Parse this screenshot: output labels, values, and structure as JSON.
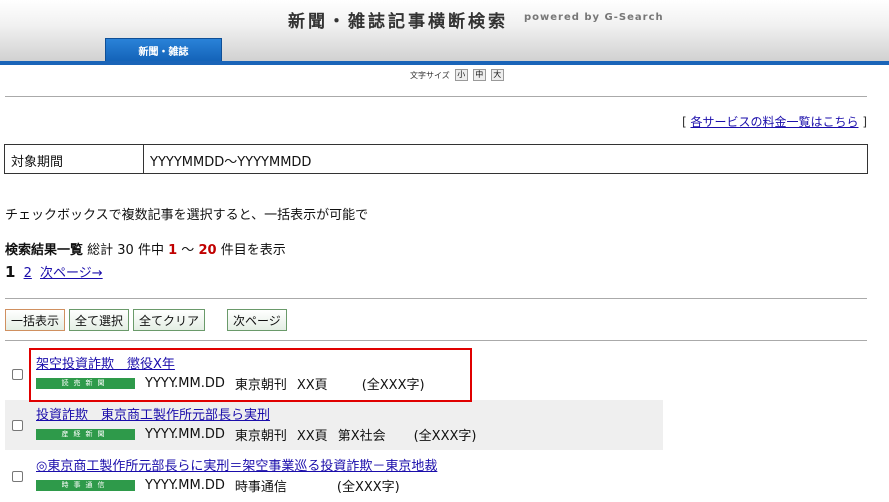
{
  "header": {
    "title": "新聞・雑誌記事横断検索",
    "powered": "powered by G-Search",
    "tab_label": "新聞・雑誌"
  },
  "font_size": {
    "label": "文字サイズ",
    "options": [
      "小",
      "中",
      "大"
    ]
  },
  "price_link": {
    "open": "[ ",
    "label": "各サービスの料金一覧はこちら",
    "close": " ]"
  },
  "period": {
    "label": "対象期間",
    "value": "YYYYMMDD〜YYYYMMDD"
  },
  "hint": "チェックボックスで複数記事を選択すると、一括表示が可能で",
  "summary": {
    "heading": "検索結果一覧",
    "text_pre": "総計 30 件中",
    "from": "1",
    "sep": "〜",
    "to": "20",
    "text_post": "件目を表示"
  },
  "pagination": {
    "current": "1",
    "page2": "2",
    "next": "次ページ→"
  },
  "buttons": {
    "bulk_view": "一括表示",
    "select_all": "全て選択",
    "clear_all": "全てクリア",
    "next_page": "次ページ"
  },
  "results": [
    {
      "title": "架空投資詐欺　懲役X年",
      "source": "読売新聞",
      "date": "YYYY.MM.DD",
      "edition": "東京朝刊",
      "page": "XX頁",
      "section": "",
      "chars": "(全XXX字)"
    },
    {
      "title": "投資詐欺　東京商工製作所元部長ら実刑",
      "source": "産経新聞",
      "date": "YYYY.MM.DD",
      "edition": "東京朝刊",
      "page": "XX頁",
      "section": "第X社会",
      "chars": "(全XXX字)"
    },
    {
      "title": "◎東京商工製作所元部長らに実刑＝架空事業巡る投資詐欺－東京地裁",
      "source": "時事通信",
      "date": "YYYY.MM.DD",
      "edition": "時事通信",
      "page": "",
      "section": "",
      "chars": "(全XXX字)"
    }
  ],
  "colors": {
    "tab_blue": "#1a64b8",
    "badge_green": "#2e9a4a",
    "highlight_red": "#e00000",
    "count_red": "#c00000"
  }
}
